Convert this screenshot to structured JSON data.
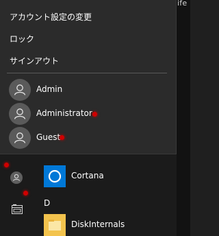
{
  "edge": {
    "text": "ife"
  },
  "account_menu": {
    "items": [
      {
        "label": "アカウント設定の変更"
      },
      {
        "label": "ロック"
      },
      {
        "label": "サインアウト"
      }
    ],
    "users": [
      {
        "name": "Admin",
        "icon": "user-avatar-icon"
      },
      {
        "name": "Administrator",
        "icon": "user-avatar-icon"
      },
      {
        "name": "Guest",
        "icon": "user-avatar-icon"
      }
    ]
  },
  "rail": {
    "items": [
      {
        "icon": "user-avatar-icon"
      },
      {
        "icon": "file-explorer-icon"
      }
    ]
  },
  "apps": {
    "entries": [
      {
        "label": "Cortana",
        "icon": "cortana-icon",
        "color": "#0078d7"
      },
      {
        "group": "D"
      },
      {
        "label": "DiskInternals",
        "icon": "folder-icon",
        "color": "#f3c34d"
      }
    ]
  },
  "markers": {
    "color": "#d00000"
  }
}
